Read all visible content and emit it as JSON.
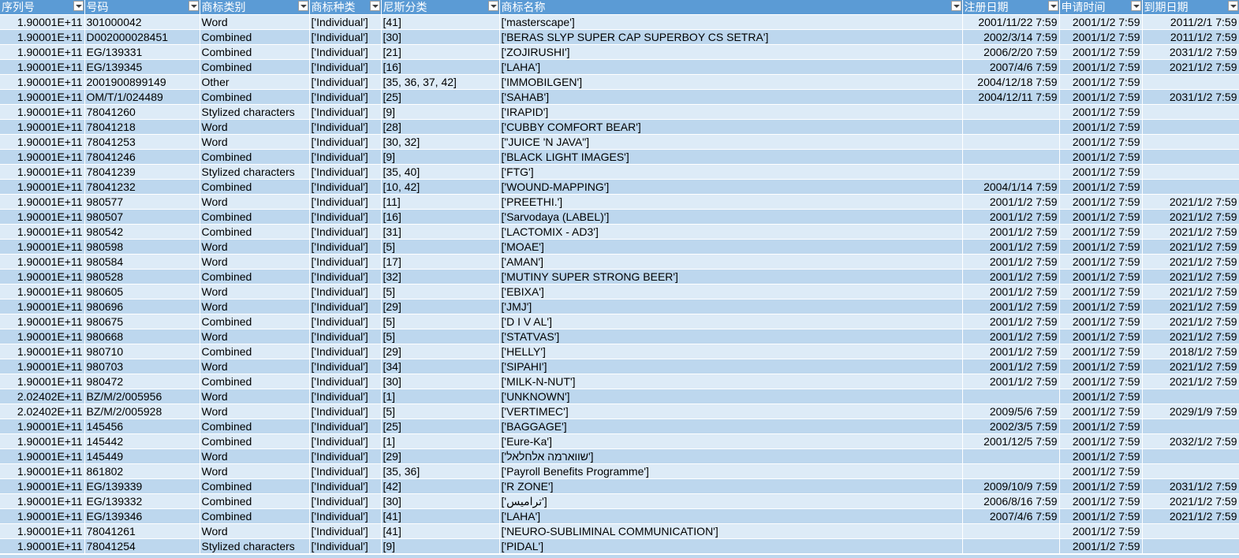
{
  "columns": [
    {
      "key": "serial",
      "label": "序列号",
      "align": "num"
    },
    {
      "key": "number",
      "label": "号码",
      "align": "left"
    },
    {
      "key": "category",
      "label": "商标类别",
      "align": "left"
    },
    {
      "key": "kind",
      "label": "商标种类",
      "align": "left"
    },
    {
      "key": "nice",
      "label": "尼斯分类",
      "align": "left"
    },
    {
      "key": "name",
      "label": "商标名称",
      "align": "left"
    },
    {
      "key": "reg_date",
      "label": "注册日期",
      "align": "num"
    },
    {
      "key": "app_time",
      "label": "申请时间",
      "align": "num"
    },
    {
      "key": "exp_date",
      "label": "到期日期",
      "align": "num"
    }
  ],
  "rows": [
    [
      "1.90001E+11",
      "301000042",
      "Word",
      "['Individual']",
      "[41]",
      "['masterscape']",
      "2001/11/22 7:59",
      "2001/1/2 7:59",
      "2011/2/1 7:59"
    ],
    [
      "1.90001E+11",
      "D002000028451",
      "Combined",
      "['Individual']",
      "[30]",
      "['BERAS SLYP SUPER CAP SUPERBOY CS SETRA']",
      "2002/3/14 7:59",
      "2001/1/2 7:59",
      "2011/1/2 7:59"
    ],
    [
      "1.90001E+11",
      "EG/139331",
      "Combined",
      "['Individual']",
      "[21]",
      "['ZOJIRUSHI']",
      "2006/2/20 7:59",
      "2001/1/2 7:59",
      "2031/1/2 7:59"
    ],
    [
      "1.90001E+11",
      "EG/139345",
      "Combined",
      "['Individual']",
      "[16]",
      "['LAHA']",
      "2007/4/6 7:59",
      "2001/1/2 7:59",
      "2021/1/2 7:59"
    ],
    [
      "1.90001E+11",
      "2001900899149",
      "Other",
      "['Individual']",
      "[35, 36, 37, 42]",
      "['IMMOBILGEN']",
      "2004/12/18 7:59",
      "2001/1/2 7:59",
      ""
    ],
    [
      "1.90001E+11",
      "OM/T/1/024489",
      "Combined",
      "['Individual']",
      "[25]",
      "['SAHAB']",
      "2004/12/11 7:59",
      "2001/1/2 7:59",
      "2031/1/2 7:59"
    ],
    [
      "1.90001E+11",
      "78041260",
      "Stylized characters",
      "['Individual']",
      "[9]",
      "['IRAPID']",
      "",
      "2001/1/2 7:59",
      ""
    ],
    [
      "1.90001E+11",
      "78041218",
      "Word",
      "['Individual']",
      "[28]",
      "['CUBBY COMFORT BEAR']",
      "",
      "2001/1/2 7:59",
      ""
    ],
    [
      "1.90001E+11",
      "78041253",
      "Word",
      "['Individual']",
      "[30, 32]",
      "[\"JUICE 'N JAVA\"]",
      "",
      "2001/1/2 7:59",
      ""
    ],
    [
      "1.90001E+11",
      "78041246",
      "Combined",
      "['Individual']",
      "[9]",
      "['BLACK LIGHT IMAGES']",
      "",
      "2001/1/2 7:59",
      ""
    ],
    [
      "1.90001E+11",
      "78041239",
      "Stylized characters",
      "['Individual']",
      "[35, 40]",
      "['FTG']",
      "",
      "2001/1/2 7:59",
      ""
    ],
    [
      "1.90001E+11",
      "78041232",
      "Combined",
      "['Individual']",
      "[10, 42]",
      "['WOUND-MAPPING']",
      "2004/1/14 7:59",
      "2001/1/2 7:59",
      ""
    ],
    [
      "1.90001E+11",
      "980577",
      "Word",
      "['Individual']",
      "[11]",
      "['PREETHI.']",
      "2001/1/2 7:59",
      "2001/1/2 7:59",
      "2021/1/2 7:59"
    ],
    [
      "1.90001E+11",
      "980507",
      "Combined",
      "['Individual']",
      "[16]",
      "['Sarvodaya  (LABEL)']",
      "2001/1/2 7:59",
      "2001/1/2 7:59",
      "2021/1/2 7:59"
    ],
    [
      "1.90001E+11",
      "980542",
      "Combined",
      "['Individual']",
      "[31]",
      "['LACTOMIX - AD3']",
      "2001/1/2 7:59",
      "2001/1/2 7:59",
      "2021/1/2 7:59"
    ],
    [
      "1.90001E+11",
      "980598",
      "Word",
      "['Individual']",
      "[5]",
      "['MOAE']",
      "2001/1/2 7:59",
      "2001/1/2 7:59",
      "2021/1/2 7:59"
    ],
    [
      "1.90001E+11",
      "980584",
      "Word",
      "['Individual']",
      "[17]",
      "['AMAN']",
      "2001/1/2 7:59",
      "2001/1/2 7:59",
      "2021/1/2 7:59"
    ],
    [
      "1.90001E+11",
      "980528",
      "Combined",
      "['Individual']",
      "[32]",
      "['MUTINY SUPER STRONG BEER']",
      "2001/1/2 7:59",
      "2001/1/2 7:59",
      "2021/1/2 7:59"
    ],
    [
      "1.90001E+11",
      "980605",
      "Word",
      "['Individual']",
      "[5]",
      "['EBIXA']",
      "2001/1/2 7:59",
      "2001/1/2 7:59",
      "2021/1/2 7:59"
    ],
    [
      "1.90001E+11",
      "980696",
      "Word",
      "['Individual']",
      "[29]",
      "['JMJ']",
      "2001/1/2 7:59",
      "2001/1/2 7:59",
      "2021/1/2 7:59"
    ],
    [
      "1.90001E+11",
      "980675",
      "Combined",
      "['Individual']",
      "[5]",
      "['D I V AL']",
      "2001/1/2 7:59",
      "2001/1/2 7:59",
      "2021/1/2 7:59"
    ],
    [
      "1.90001E+11",
      "980668",
      "Word",
      "['Individual']",
      "[5]",
      "['STATVAS']",
      "2001/1/2 7:59",
      "2001/1/2 7:59",
      "2021/1/2 7:59"
    ],
    [
      "1.90001E+11",
      "980710",
      "Combined",
      "['Individual']",
      "[29]",
      "['HELLY']",
      "2001/1/2 7:59",
      "2001/1/2 7:59",
      "2018/1/2 7:59"
    ],
    [
      "1.90001E+11",
      "980703",
      "Word",
      "['Individual']",
      "[34]",
      "['SIPAHI']",
      "2001/1/2 7:59",
      "2001/1/2 7:59",
      "2021/1/2 7:59"
    ],
    [
      "1.90001E+11",
      "980472",
      "Combined",
      "['Individual']",
      "[30]",
      "['MILK-N-NUT']",
      "2001/1/2 7:59",
      "2001/1/2 7:59",
      "2021/1/2 7:59"
    ],
    [
      "2.02402E+11",
      "BZ/M/2/005956",
      "Word",
      "['Individual']",
      "[1]",
      "['UNKNOWN']",
      "",
      "2001/1/2 7:59",
      ""
    ],
    [
      "2.02402E+11",
      "BZ/M/2/005928",
      "Word",
      "['Individual']",
      "[5]",
      "['VERTIMEC']",
      "2009/5/6 7:59",
      "2001/1/2 7:59",
      "2029/1/9 7:59"
    ],
    [
      "1.90001E+11",
      "145456",
      "Combined",
      "['Individual']",
      "[25]",
      "['BAGGAGE']",
      "2002/3/5 7:59",
      "2001/1/2 7:59",
      ""
    ],
    [
      "1.90001E+11",
      "145442",
      "Combined",
      "['Individual']",
      "[1]",
      "['Eure-Ka']",
      "2001/12/5 7:59",
      "2001/1/2 7:59",
      "2032/1/2 7:59"
    ],
    [
      "1.90001E+11",
      "145449",
      "Word",
      "['Individual']",
      "[29]",
      "['שווארמה אלחלאל']",
      "",
      "2001/1/2 7:59",
      ""
    ],
    [
      "1.90001E+11",
      "861802",
      "Word",
      "['Individual']",
      "[35, 36]",
      "['Payroll Benefits Programme']",
      "",
      "2001/1/2 7:59",
      ""
    ],
    [
      "1.90001E+11",
      "EG/139339",
      "Combined",
      "['Individual']",
      "[42]",
      "['R ZONE']",
      "2009/10/9 7:59",
      "2001/1/2 7:59",
      "2031/1/2 7:59"
    ],
    [
      "1.90001E+11",
      "EG/139332",
      "Combined",
      "['Individual']",
      "[30]",
      "['تراميس']",
      "2006/8/16 7:59",
      "2001/1/2 7:59",
      "2021/1/2 7:59"
    ],
    [
      "1.90001E+11",
      "EG/139346",
      "Combined",
      "['Individual']",
      "[41]",
      "['LAHA']",
      "2007/4/6 7:59",
      "2001/1/2 7:59",
      "2021/1/2 7:59"
    ],
    [
      "1.90001E+11",
      "78041261",
      "Word",
      "['Individual']",
      "[41]",
      "['NEURO-SUBLIMINAL COMMUNICATION']",
      "",
      "2001/1/2 7:59",
      ""
    ],
    [
      "1.90001E+11",
      "78041254",
      "Stylized characters",
      "['Individual']",
      "[9]",
      "['PIDAL']",
      "",
      "2001/1/2 7:59",
      ""
    ]
  ],
  "colors": {
    "header": "#5b9bd5",
    "band_light": "#ddebf7",
    "band_dark": "#bdd7ee"
  }
}
